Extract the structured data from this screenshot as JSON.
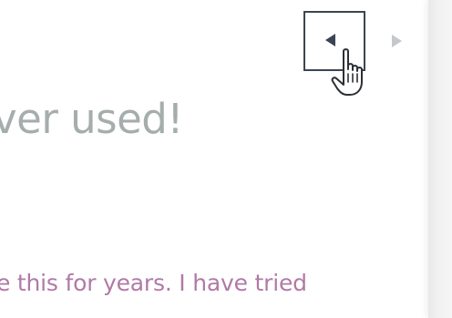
{
  "content": {
    "heading": "ver used!",
    "body": "e this for years. I have tried"
  },
  "carousel": {
    "prev_icon": "triangle-left",
    "next_icon": "triangle-right"
  },
  "cursor": {
    "icon": "pointer-hand"
  },
  "colors": {
    "heading": "#a6adad",
    "body": "#b07aa6",
    "nav_active": "#3b4552",
    "nav_inactive": "#c4c7cb",
    "side_panel": "#f1f1f2"
  }
}
